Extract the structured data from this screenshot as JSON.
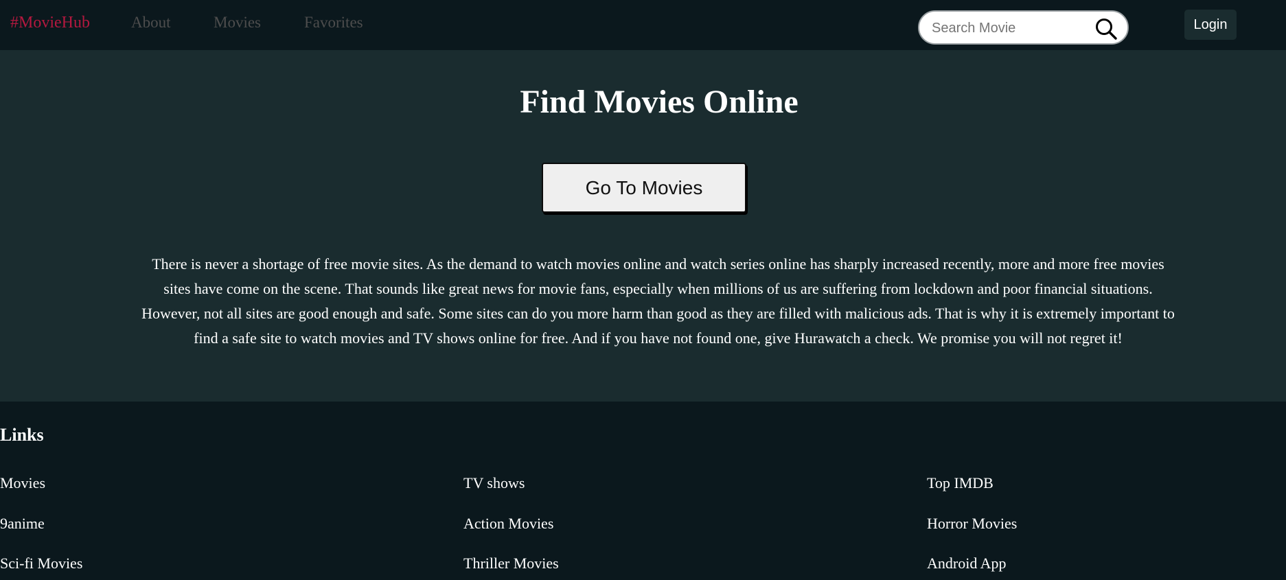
{
  "navbar": {
    "brand": "#MovieHub",
    "links": [
      "About",
      "Movies",
      "Favorites"
    ],
    "search": {
      "placeholder": "Search Movie",
      "value": ""
    },
    "login_label": "Login"
  },
  "hero": {
    "title": "Find Movies Online",
    "button_label": "Go To Movies",
    "description": "There is never a shortage of free movie sites. As the demand to watch movies online and watch series online has sharply increased recently, more and more free movies sites have come on the scene. That sounds like great news for movie fans, especially when millions of us are suffering from lockdown and poor financial situations. However, not all sites are good enough and safe. Some sites can do you more harm than good as they are filled with malicious ads. That is why it is extremely important to find a safe site to watch movies and TV shows online for free. And if you have not found one, give Hurawatch a check. We promise you will not regret it!"
  },
  "footer": {
    "heading": "Links",
    "links": [
      "Movies",
      "TV shows",
      "Top IMDB",
      "9anime",
      "Action Movies",
      "Horror Movies",
      "Sci-fi Movies",
      "Thriller Movies",
      "Android App"
    ]
  },
  "colors": {
    "brand": "#b3183f",
    "nav_background": "#0b181d",
    "hero_background": "#1a2c2f",
    "nav_link": "#4d4d4d"
  },
  "icons": {
    "search": "search-icon"
  }
}
